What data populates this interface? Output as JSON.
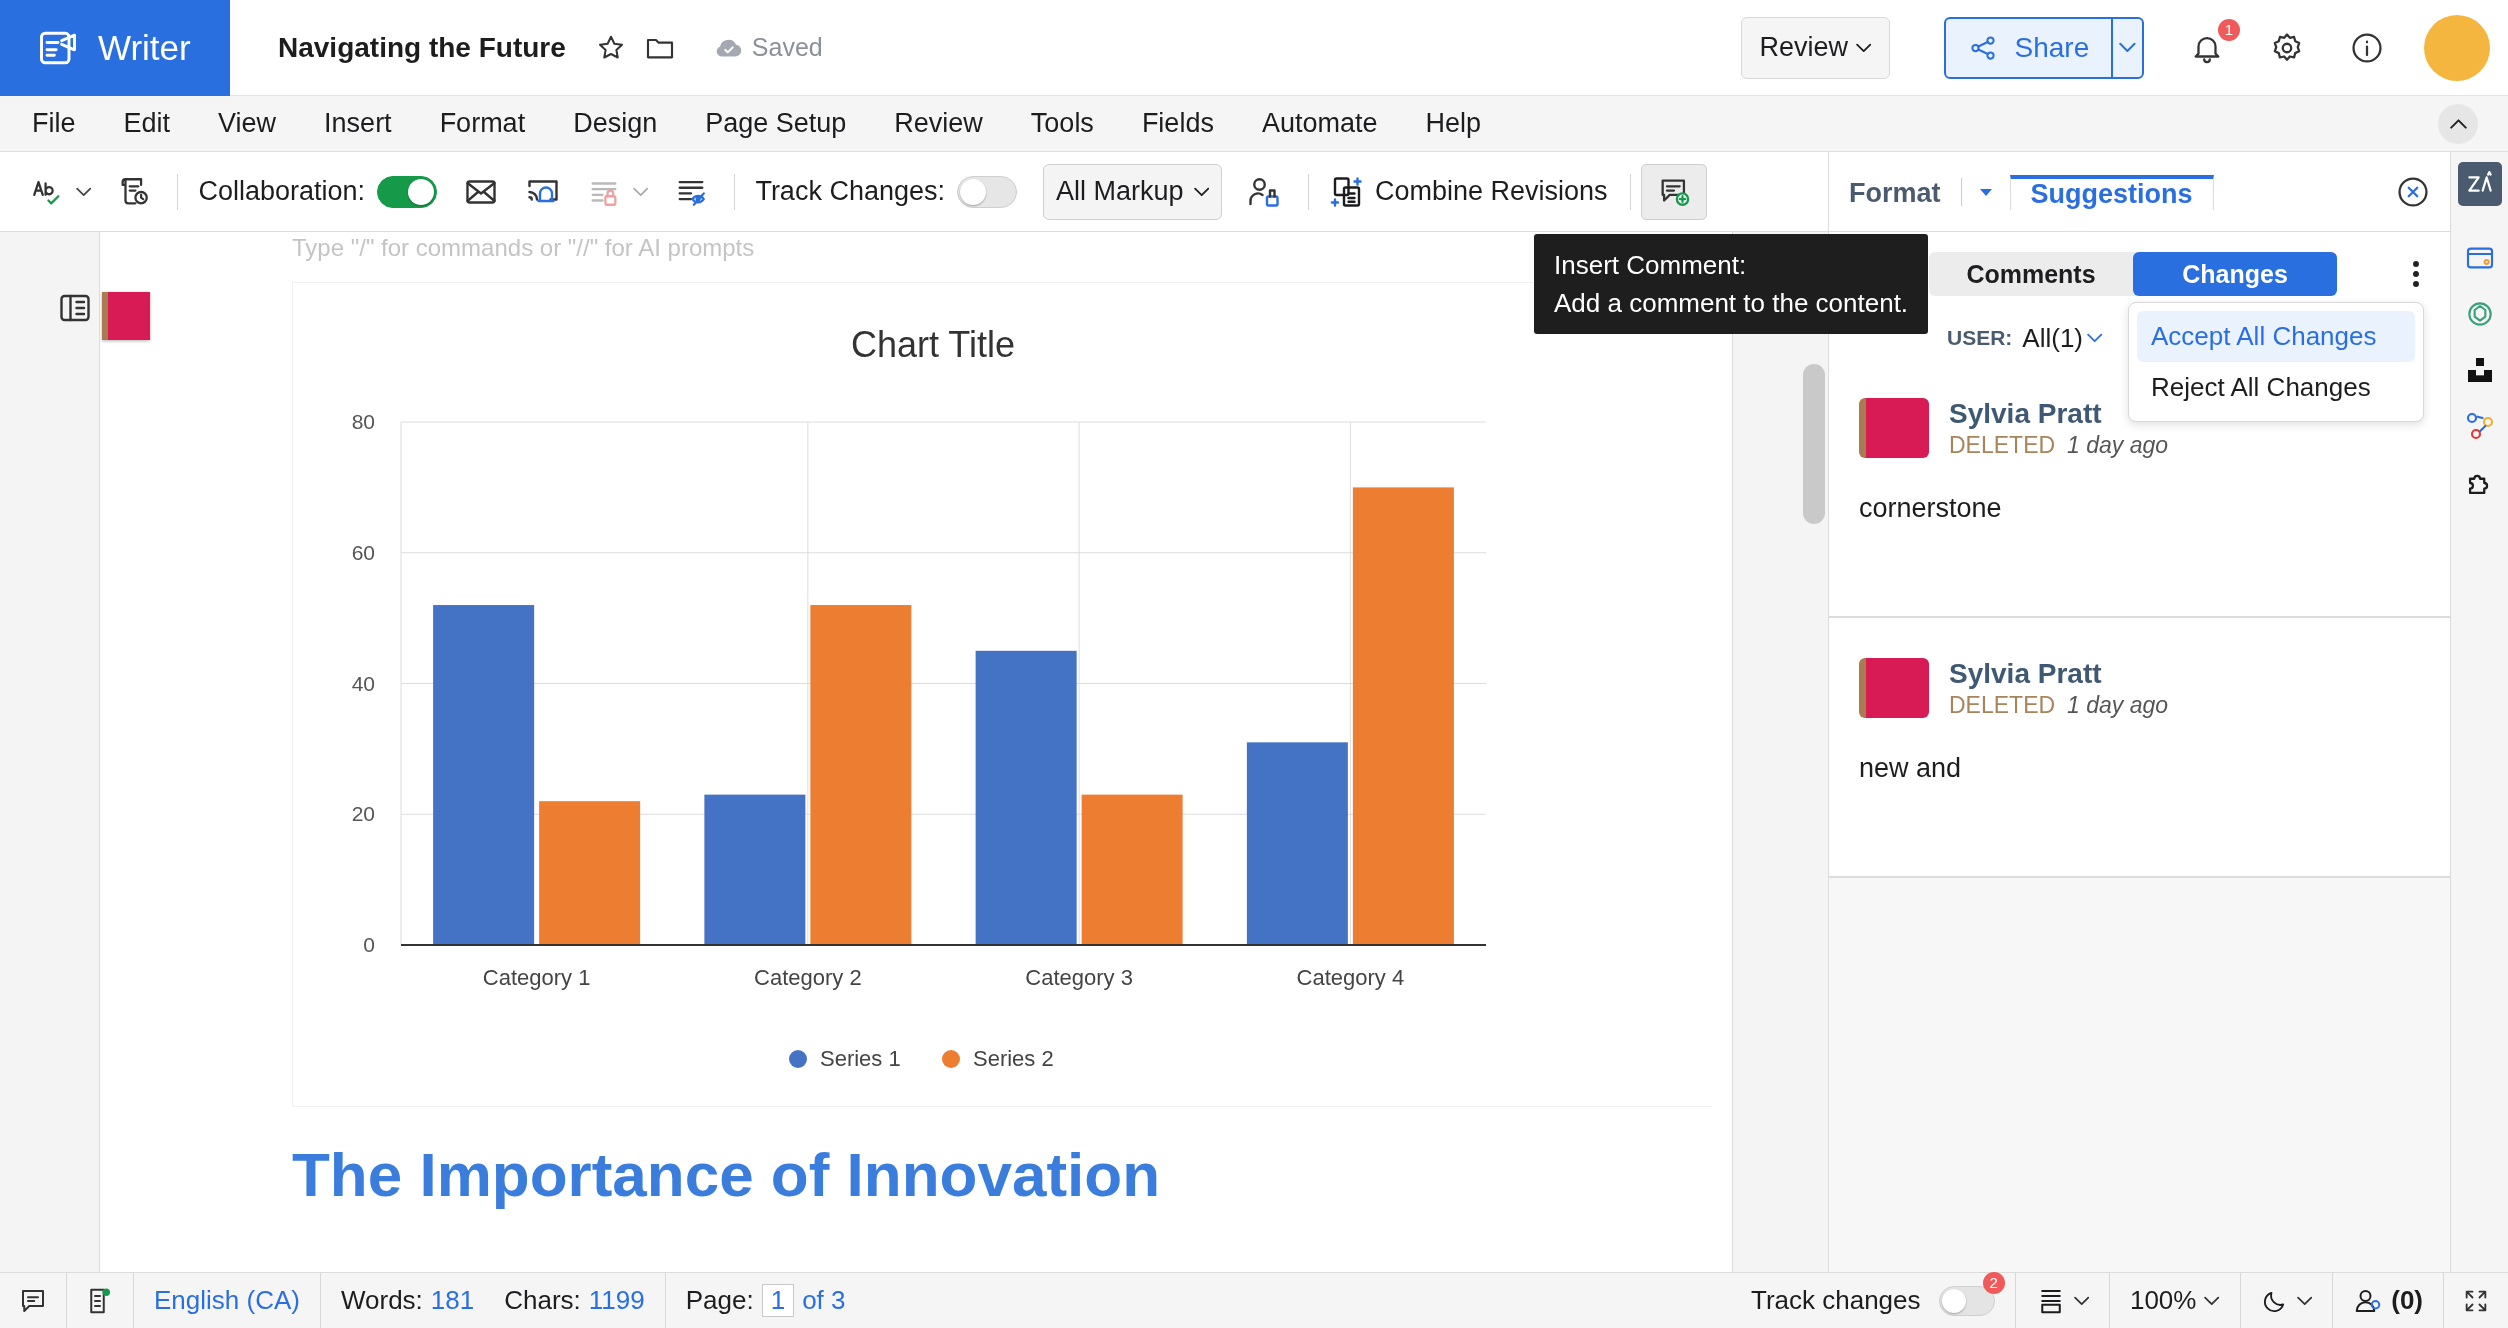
{
  "app": {
    "name": "Writer"
  },
  "document": {
    "title": "Navigating the Future",
    "saved_status": "Saved"
  },
  "header": {
    "review_button": "Review",
    "share_button": "Share",
    "notification_count": "1"
  },
  "menu": [
    "File",
    "Edit",
    "View",
    "Insert",
    "Format",
    "Design",
    "Page Setup",
    "Review",
    "Tools",
    "Fields",
    "Automate",
    "Help"
  ],
  "toolbar": {
    "collaboration_label": "Collaboration:",
    "collaboration_on": true,
    "track_changes_label": "Track Changes:",
    "track_changes_on": false,
    "markup": "All Markup",
    "combine_revisions": "Combine Revisions"
  },
  "tooltip": {
    "title": "Insert Comment:",
    "text": "Add a comment to the content."
  },
  "editor": {
    "placeholder": "Type \"/\" for commands or \"//\" for AI prompts",
    "chart": {
      "chart_data": {
        "type": "bar",
        "title": "Chart Title",
        "categories": [
          "Category 1",
          "Category 2",
          "Category 3",
          "Category 4"
        ],
        "series": [
          {
            "name": "Series 1",
            "color": "#4472c4",
            "values": [
              52,
              23,
              45,
              31
            ]
          },
          {
            "name": "Series 2",
            "color": "#ed7d31",
            "values": [
              22,
              52,
              23,
              70
            ]
          }
        ],
        "ylim": [
          0,
          80
        ],
        "yticks": [
          0,
          20,
          40,
          60,
          80
        ],
        "grid": true,
        "legend": true
      }
    },
    "heading": "The Importance of Innovation"
  },
  "side_panel": {
    "tabs": [
      {
        "label": "Format",
        "selected": false
      },
      {
        "label": "Suggestions",
        "selected": true
      }
    ],
    "subtabs": [
      {
        "label": "Comments",
        "selected": false
      },
      {
        "label": "Changes",
        "selected": true
      }
    ],
    "user_filter_label": "USER:",
    "user_filter_value": "All(1)",
    "menu": [
      {
        "label": "Accept All Changes",
        "selected": true
      },
      {
        "label": "Reject All Changes",
        "selected": false
      }
    ],
    "changes": [
      {
        "author": "Sylvia Pratt",
        "action": "DELETED",
        "time": "1 day ago",
        "text": "cornerstone"
      },
      {
        "author": "Sylvia Pratt",
        "action": "DELETED",
        "time": "1 day ago",
        "text": "new and"
      }
    ]
  },
  "status_bar": {
    "language": "English (CA)",
    "words_label": "Words:",
    "words": "181",
    "chars_label": "Chars:",
    "chars": "1199",
    "page_label": "Page:",
    "page": "1",
    "page_total": "of 3",
    "track_changes_label": "Track changes",
    "track_changes_on": false,
    "track_changes_count": "2",
    "zoom": "100%",
    "collaborators": "(0)"
  }
}
